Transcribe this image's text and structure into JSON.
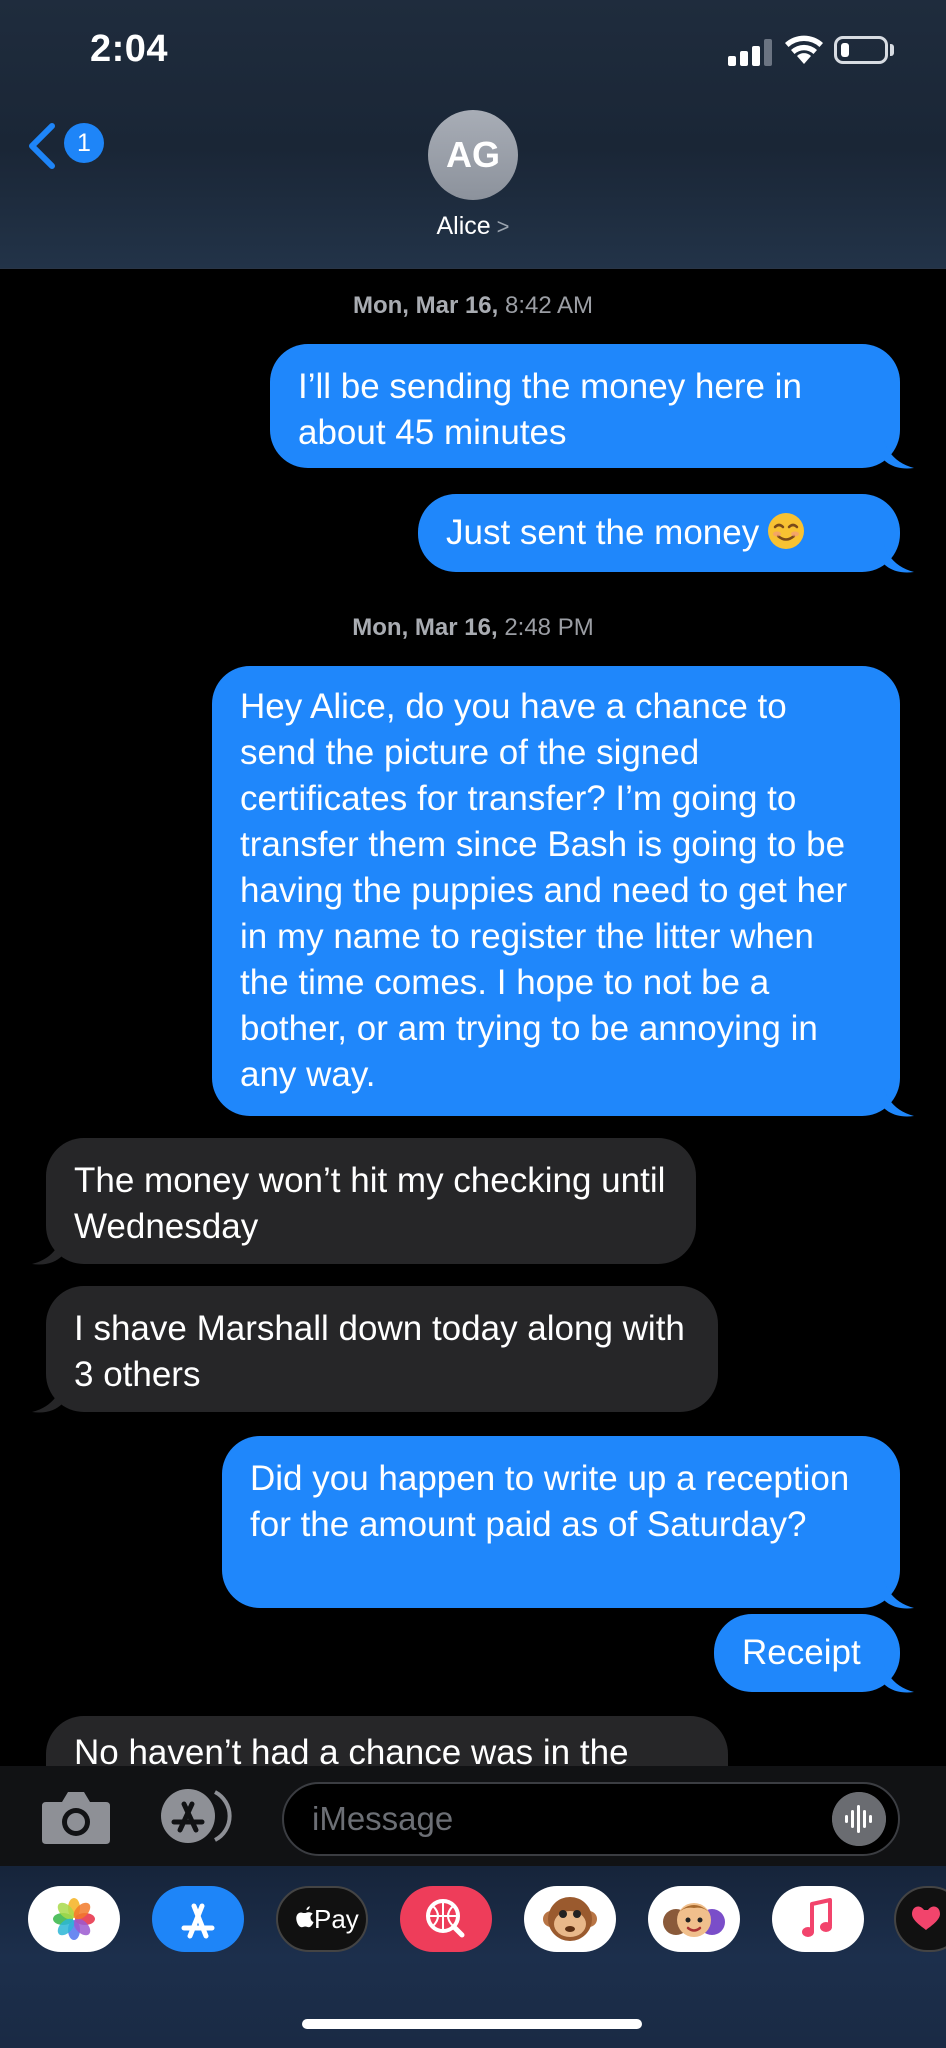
{
  "status_bar": {
    "time": "2:04"
  },
  "header": {
    "back_badge": "1",
    "avatar_initials": "AG",
    "contact_name": "Alice",
    "contact_chevron": ">"
  },
  "conversation": {
    "timestamps": [
      {
        "day": "Mon, Mar 16,",
        "time": "8:42 AM"
      },
      {
        "day": "Mon, Mar 16,",
        "time": "2:48 PM"
      }
    ],
    "messages": [
      {
        "direction": "outgoing",
        "text": "I’ll be sending the money here in about 45 minutes"
      },
      {
        "direction": "outgoing",
        "text": "Just sent the money",
        "emoji": "smiling-face-icon"
      },
      {
        "direction": "outgoing",
        "text": "Hey Alice, do you have a chance to send the picture of the signed certificates for transfer? I’m going to transfer them since Bash is going to be having the puppies and need to get her in my name to register the litter when the time comes. I hope to not be a bother, or am trying to be annoying in any way."
      },
      {
        "direction": "incoming",
        "text": "The money won’t hit my checking until Wednesday"
      },
      {
        "direction": "incoming",
        "text": "I shave Marshall down  today along with 3 others"
      },
      {
        "direction": "outgoing",
        "text": "Did you happen to write up a reception for the amount paid as of Saturday?"
      },
      {
        "direction": "outgoing",
        "text": "Receipt"
      },
      {
        "direction": "incoming",
        "text": "No haven’t had a chance was in the"
      }
    ]
  },
  "composer": {
    "placeholder": "iMessage"
  },
  "app_drawer": {
    "apps": [
      {
        "name": "photos-app-icon"
      },
      {
        "name": "app-store-icon"
      },
      {
        "name": "apple-pay-icon",
        "label": "Pay"
      },
      {
        "name": "search-images-icon"
      },
      {
        "name": "animoji-monkey-icon"
      },
      {
        "name": "memoji-icon"
      },
      {
        "name": "music-icon"
      },
      {
        "name": "digital-touch-icon"
      }
    ]
  },
  "colors": {
    "outgoing_bubble": "#1f87fb",
    "incoming_bubble": "#262628",
    "accent": "#1e85f8"
  }
}
